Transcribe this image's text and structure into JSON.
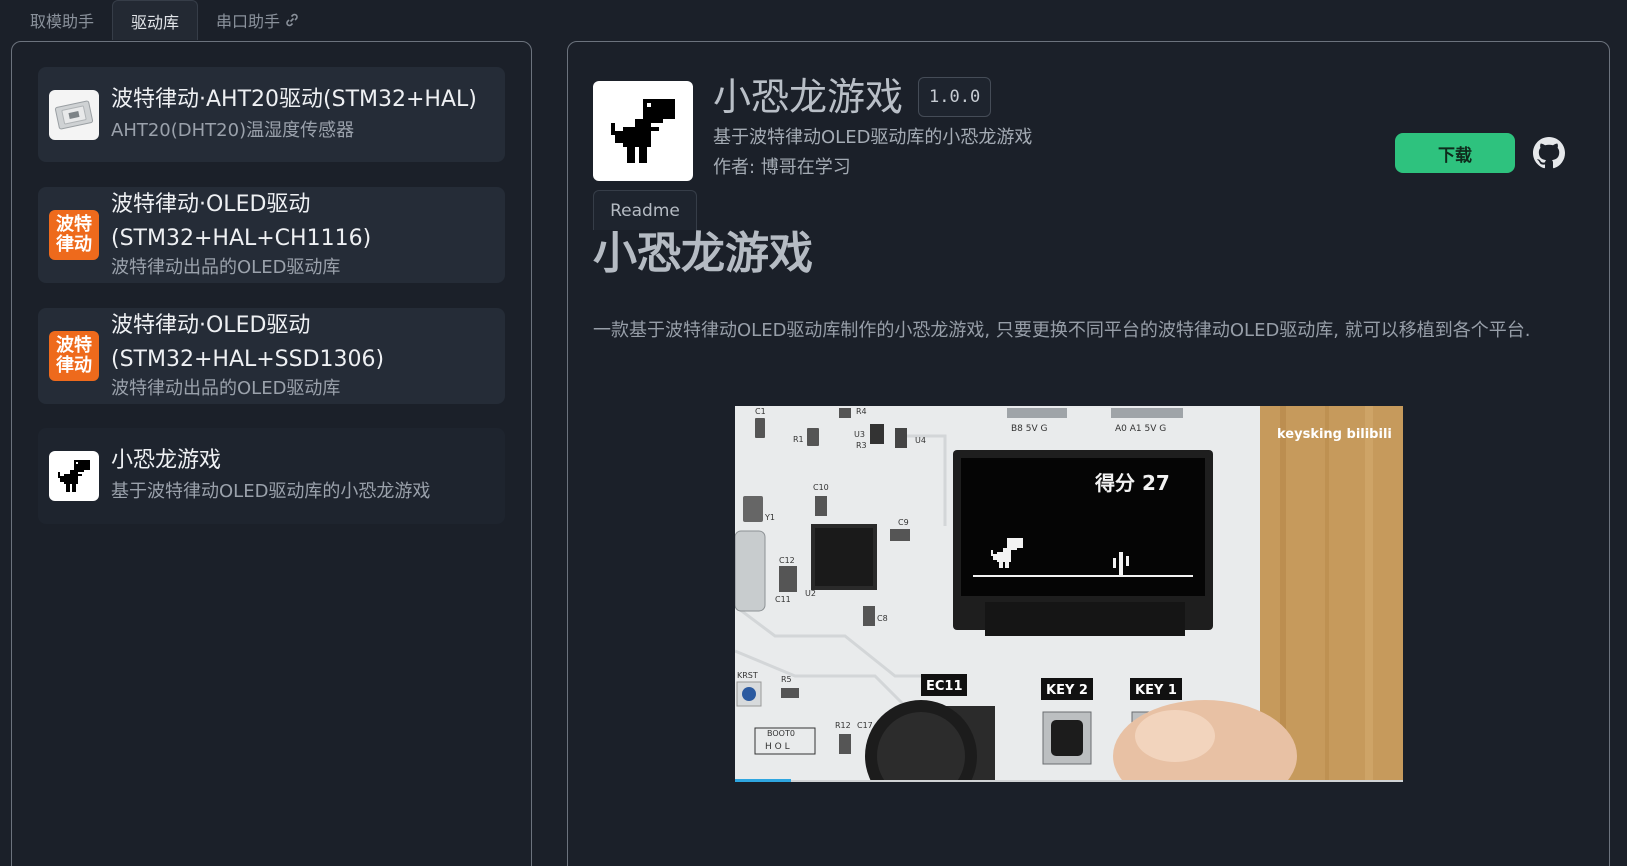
{
  "tabs": [
    {
      "label": "取模助手"
    },
    {
      "label": "驱动库"
    },
    {
      "label": "串口助手"
    }
  ],
  "libraries": [
    {
      "title": "波特律动·AHT20驱动(STM32+HAL)",
      "desc": "AHT20(DHT20)温湿度传感器",
      "icon": "sensor-chip-icon"
    },
    {
      "title": "波特律动·OLED驱动\n(STM32+HAL+CH1116)",
      "desc": "波特律动出品的OLED驱动库",
      "icon": "brand-logo-icon",
      "badge_top": "波特",
      "badge_bottom": "律动"
    },
    {
      "title": "波特律动·OLED驱动\n(STM32+HAL+SSD1306)",
      "desc": "波特律动出品的OLED驱动库",
      "icon": "brand-logo-icon",
      "badge_top": "波特",
      "badge_bottom": "律动"
    },
    {
      "title": "小恐龙游戏",
      "desc": "基于波特律动OLED驱动库的小恐龙游戏",
      "icon": "dino-icon"
    }
  ],
  "detail": {
    "title": "小恐龙游戏",
    "version": "1.0.0",
    "desc": "基于波特律动OLED驱动库的小恐龙游戏",
    "author": "作者: 博哥在学习",
    "download_label": "下载",
    "readme_tab": "Readme",
    "readme_heading": "小恐龙游戏",
    "readme_body": "一款基于波特律动OLED驱动库制作的小恐龙游戏, 只要更换不同平台的波特律动OLED驱动库, 就可以移植到各个平台."
  },
  "photo": {
    "score_text": "得分 27",
    "watermark": "keysking bilibili",
    "labels": {
      "key1": "KEY 1",
      "key2": "KEY 2",
      "ec11": "EC11",
      "pins1": "B8 5V G",
      "pins2": "A0 A1 5V G",
      "krst": "KRST",
      "boot": "BOOT0",
      "hol": "H O L",
      "c1": "C1",
      "r1": "R1",
      "r4": "R4",
      "u3": "U3",
      "r3": "R3",
      "u4": "U4",
      "c10": "C10",
      "y1": "Y1",
      "c9": "C9",
      "c12": "C12",
      "c11": "C11",
      "u2": "U2",
      "c8": "C8",
      "r5": "R5",
      "r12": "R12",
      "c17": "C17"
    }
  },
  "colors": {
    "accent": "#2ec27e",
    "brand": "#ee6a1c",
    "background": "#1b2029"
  }
}
